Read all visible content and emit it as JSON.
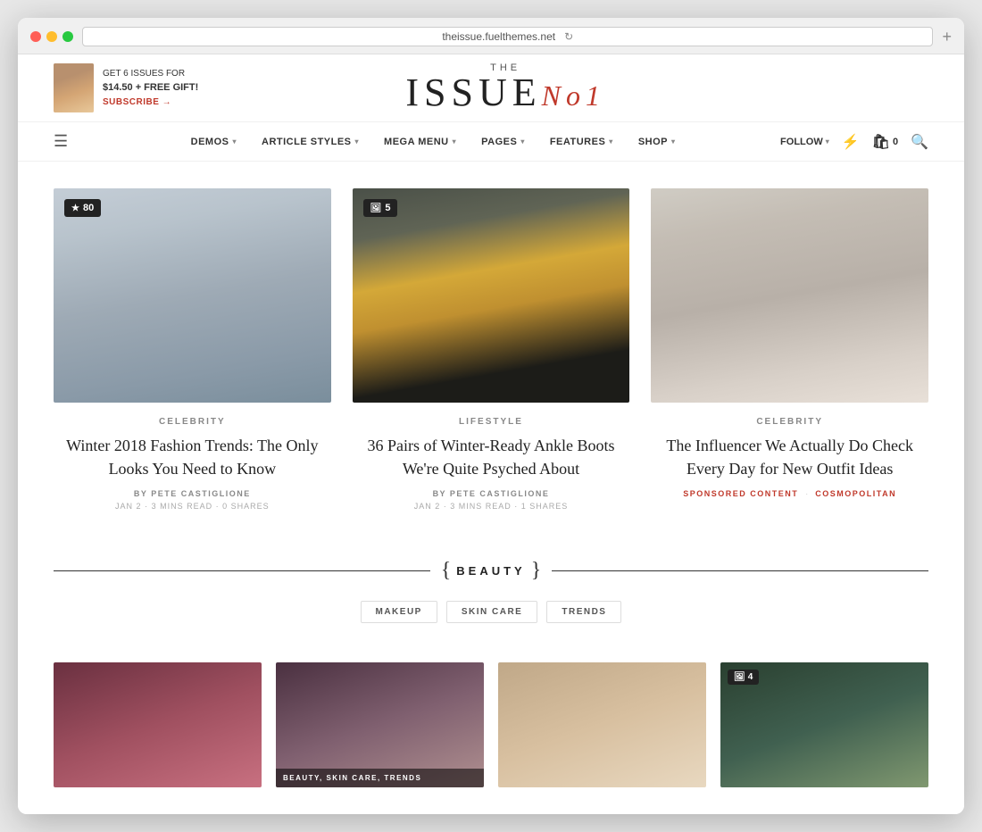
{
  "browser": {
    "url": "theissue.fuelthemes.net",
    "reload_icon": "↻",
    "new_tab": "+"
  },
  "promo": {
    "label_issues": "GET 6 ISSUES FOR",
    "price": "$14.50 + FREE GIFT!",
    "subscribe": "SUBSCRIBE →"
  },
  "logo": {
    "the": "THE",
    "main": "ISSUE",
    "accent": "No1"
  },
  "nav": {
    "hamburger": "☰",
    "items": [
      {
        "label": "DEMOS",
        "has_dropdown": true
      },
      {
        "label": "ARTICLE STYLES",
        "has_dropdown": true
      },
      {
        "label": "MEGA MENU",
        "has_dropdown": true
      },
      {
        "label": "PAGES",
        "has_dropdown": true
      },
      {
        "label": "FEATURES",
        "has_dropdown": true
      },
      {
        "label": "SHOP",
        "has_dropdown": true
      }
    ],
    "right": {
      "follow": "FOLLOW",
      "bolt_icon": "⚡",
      "cart_icon": "🛍",
      "cart_count": "0",
      "search_icon": "🔍"
    }
  },
  "articles": [
    {
      "category": "CELEBRITY",
      "title": "Winter 2018 Fashion Trends: The Only Looks You Need to Know",
      "author": "BY PETE CASTIGLIONE",
      "date": "JAN 2",
      "read_time": "3 MINS READ",
      "shares": "0 SHARES",
      "badge": "80",
      "badge_type": "star",
      "img_class": "figure-fashion1"
    },
    {
      "category": "LIFESTYLE",
      "title": "36 Pairs of Winter-Ready Ankle Boots We're Quite Psyched About",
      "author": "BY PETE CASTIGLIONE",
      "date": "JAN 2",
      "read_time": "3 MINS READ",
      "shares": "1 SHARES",
      "badge": "5",
      "badge_type": "image",
      "img_class": "figure-lifestyle"
    },
    {
      "category": "CELEBRITY",
      "title": "The Influencer We Actually Do Check Every Day for New Outfit Ideas",
      "author": null,
      "date": null,
      "read_time": null,
      "shares": null,
      "badge": null,
      "badge_type": null,
      "img_class": "figure-celeb",
      "tags": [
        "SPONSORED CONTENT",
        "COSMOPOLITAN"
      ]
    }
  ],
  "beauty_section": {
    "title": "BEAUTY",
    "brace_open": "{",
    "brace_close": "}",
    "subtabs": [
      "MAKEUP",
      "SKIN CARE",
      "TRENDS"
    ]
  },
  "bottom_cards": [
    {
      "img_class": "bottom-img1",
      "label": null,
      "badge": null
    },
    {
      "img_class": "bottom-img2",
      "label": "BEAUTY, SKIN CARE, TRENDS",
      "badge": null
    },
    {
      "img_class": "bottom-img3",
      "label": null,
      "badge": null
    },
    {
      "img_class": "bottom-img4",
      "label": null,
      "badge": "4",
      "badge_type": "image"
    }
  ]
}
